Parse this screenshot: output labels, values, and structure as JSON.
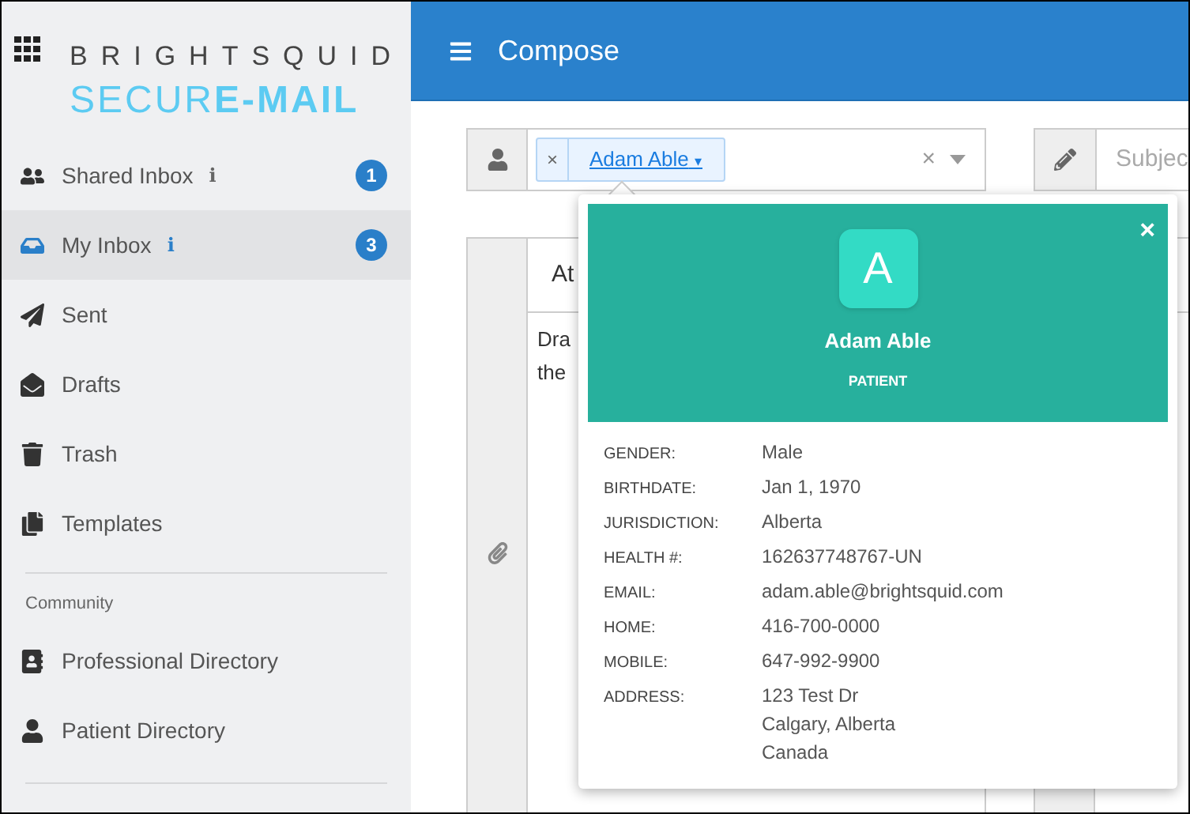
{
  "logo": {
    "brand": "BRIGHTSQUID",
    "product": "SECUR**E-MAIL**"
  },
  "sidebar": {
    "sections": [
      {
        "items": [
          {
            "label": "Shared Inbox",
            "info": "i",
            "badge": "1",
            "selected": false
          },
          {
            "label": "My Inbox",
            "info": "i",
            "badge": "3",
            "selected": true
          },
          {
            "label": "Sent",
            "selected": false
          },
          {
            "label": "Drafts",
            "selected": false
          },
          {
            "label": "Trash",
            "selected": false
          },
          {
            "label": "Templates",
            "selected": false
          }
        ]
      },
      {
        "heading": "Community",
        "items": [
          {
            "label": "Professional Directory",
            "selected": false
          },
          {
            "label": "Patient Directory",
            "selected": false
          }
        ]
      }
    ]
  },
  "header": {
    "title": "Compose"
  },
  "recipients": {
    "chips": [
      {
        "remove": "×",
        "name": "Adam Able",
        "caret": "▾"
      }
    ],
    "clear": "×"
  },
  "subject": {
    "placeholder": "Subjec"
  },
  "body": {
    "header": "At",
    "lines": [
      "Dra",
      "the"
    ]
  },
  "popover": {
    "close": "×",
    "avatar": "A",
    "name": "Adam Able",
    "role": "PATIENT",
    "fields": [
      {
        "label": "GENDER:",
        "lines": [
          "Male"
        ]
      },
      {
        "label": "BIRTHDATE:",
        "lines": [
          "Jan 1, 1970"
        ]
      },
      {
        "label": "JURISDICTION:",
        "lines": [
          "Alberta"
        ]
      },
      {
        "label": "HEALTH #:",
        "lines": [
          "162637748767-UN"
        ]
      },
      {
        "label": "EMAIL:",
        "lines": [
          "adam.able@brightsquid.com"
        ]
      },
      {
        "label": "HOME:",
        "lines": [
          "416-700-0000"
        ]
      },
      {
        "label": "MOBILE:",
        "lines": [
          "647-992-9900"
        ]
      },
      {
        "label": "ADDRESS:",
        "lines": [
          "123 Test Dr",
          "Calgary, Alberta",
          "Canada"
        ]
      }
    ]
  }
}
